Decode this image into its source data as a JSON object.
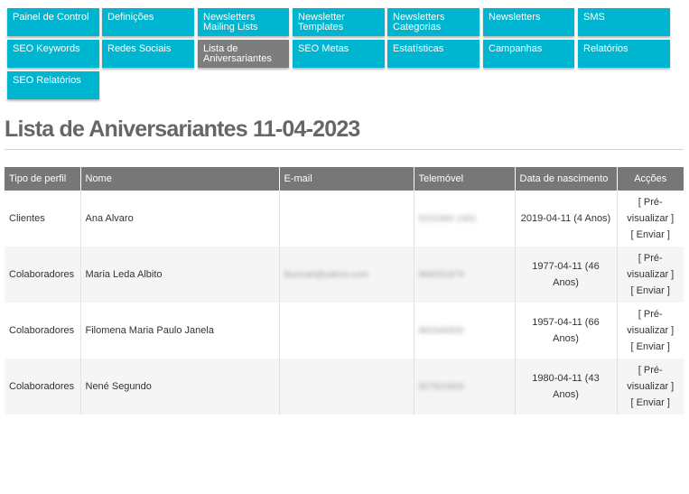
{
  "nav": {
    "items": [
      {
        "label": "Painel de Control"
      },
      {
        "label": "Definições"
      },
      {
        "label": "Newsletters\nMailing Lists"
      },
      {
        "label": "Newsletter\nTemplates"
      },
      {
        "label": "Newsletters\nCategorias"
      },
      {
        "label": "Newsletters"
      },
      {
        "label": "SMS"
      },
      {
        "label": "SEO Keywords"
      },
      {
        "label": "Redes Sociais"
      },
      {
        "label": "Lista de\nAniversariantes"
      },
      {
        "label": "SEO Metas"
      },
      {
        "label": "Estatísticas"
      },
      {
        "label": "Campanhas"
      },
      {
        "label": "Relatórios"
      },
      {
        "label": "SEO Relatórios"
      }
    ],
    "active_index": 9
  },
  "page": {
    "title": "Lista de Aniversariantes 11-04-2023"
  },
  "table": {
    "headers": {
      "type": "Tipo de perfil",
      "name": "Nome",
      "email": "E-mail",
      "mobile": "Telemóvel",
      "birth": "Data de nascimento",
      "actions": "Acções"
    },
    "rows": [
      {
        "type": "Clientes",
        "name": "Ana Alvaro",
        "email": "",
        "mobile": "9151660 1461",
        "birth": "2019-04-11 (4 Anos)"
      },
      {
        "type": "Colaboradores",
        "name": "Maria Leda Albito",
        "email": "lbuncati@yahoo.com",
        "mobile": "966051974",
        "birth": "1977-04-11 (46 Anos)"
      },
      {
        "type": "Colaboradores",
        "name": "Filomena Maria Paulo Janela",
        "email": "",
        "mobile": "960340920",
        "birth": "1957-04-11 (66 Anos)"
      },
      {
        "type": "Colaboradores",
        "name": "Nené Segundo",
        "email": "",
        "mobile": "927810604",
        "birth": "1980-04-11 (43 Anos)"
      }
    ],
    "actions": {
      "preview": "[ Pré-visualizar ]",
      "send": "[ Enviar ]"
    }
  },
  "colors": {
    "nav_bg": "#00b5cf",
    "nav_active_bg": "#7d7d7d",
    "header_bg": "#777777",
    "title": "#666666"
  }
}
